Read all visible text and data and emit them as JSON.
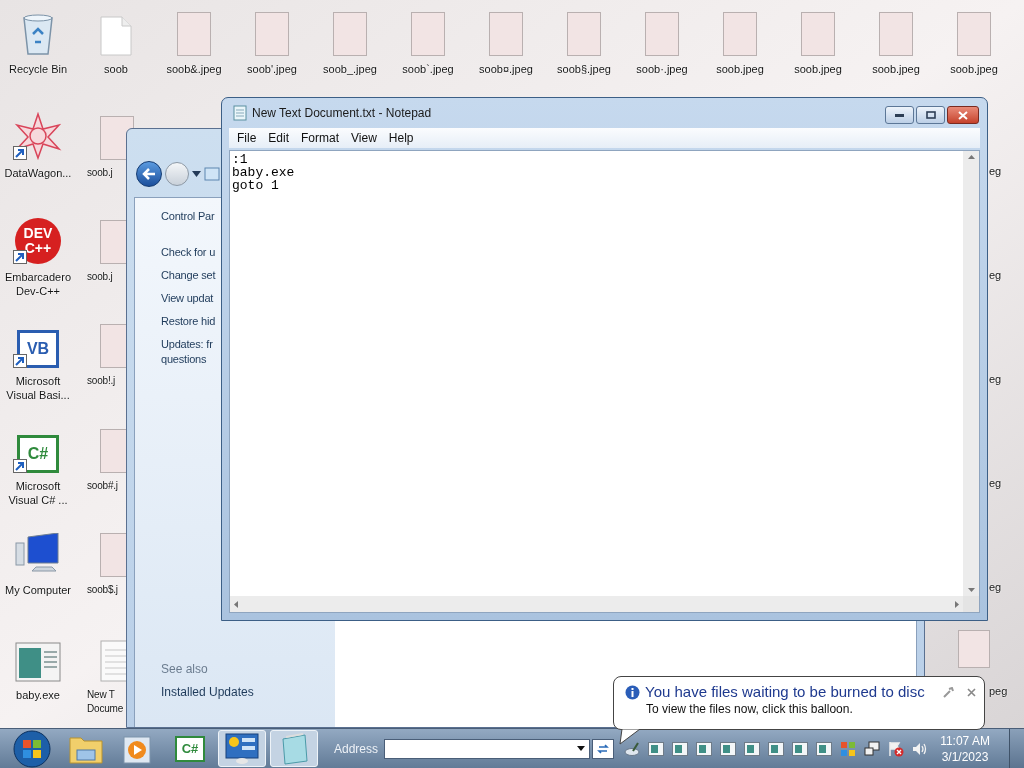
{
  "desktop": {
    "top_row": [
      {
        "kind": "recycle-bin",
        "label": [
          "Recycle Bin"
        ]
      },
      {
        "kind": "blank-file",
        "label": [
          "soob"
        ]
      },
      {
        "kind": "photo",
        "label": [
          "soob&.jpeg"
        ]
      },
      {
        "kind": "photo",
        "label": [
          "soob'.jpeg"
        ]
      },
      {
        "kind": "photo",
        "label": [
          "soob_.jpeg"
        ]
      },
      {
        "kind": "photo",
        "label": [
          "soob`.jpeg"
        ]
      },
      {
        "kind": "photo",
        "label": [
          "soob¤.jpeg"
        ]
      },
      {
        "kind": "photo",
        "label": [
          "soob§.jpeg"
        ]
      },
      {
        "kind": "photo",
        "label": [
          "soob·.jpeg"
        ]
      },
      {
        "kind": "photo",
        "label": [
          "soob.jpeg"
        ]
      },
      {
        "kind": "photo",
        "label": [
          "soob.jpeg"
        ]
      },
      {
        "kind": "photo",
        "label": [
          "soob.jpeg"
        ]
      },
      {
        "kind": "photo",
        "label": [
          "soob.jpeg"
        ]
      }
    ],
    "left_column": [
      {
        "kind": "datawagon",
        "label": [
          "DataWagon..."
        ],
        "shortcut": true
      },
      {
        "kind": "devcpp",
        "label": [
          "Embarcadero",
          "Dev-C++"
        ],
        "logo_text": [
          "DEV",
          "C++"
        ],
        "shortcut": true
      },
      {
        "kind": "vb",
        "label": [
          "Microsoft",
          "Visual Basi..."
        ],
        "logo_text": [
          "VB"
        ],
        "shortcut": true
      },
      {
        "kind": "csharp",
        "label": [
          "Microsoft",
          "Visual C# ..."
        ],
        "logo_text": [
          "C#"
        ],
        "shortcut": true
      },
      {
        "kind": "computer",
        "label": [
          "My Computer"
        ],
        "shortcut": false
      },
      {
        "kind": "exe",
        "label": [
          "baby.exe"
        ],
        "shortcut": false
      }
    ],
    "second_column": [
      {
        "kind": "photo",
        "label": [
          "soob.j"
        ]
      },
      {
        "kind": "photo",
        "label": [
          "soob.j"
        ]
      },
      {
        "kind": "photo",
        "label": [
          "soob!.j"
        ]
      },
      {
        "kind": "photo",
        "label": [
          "soob#.j"
        ]
      },
      {
        "kind": "photo",
        "label": [
          "soob$.j"
        ]
      },
      {
        "kind": "text-file",
        "label": [
          "New T",
          "Docume"
        ]
      }
    ],
    "right_column": [
      {
        "kind": "hidden",
        "label": "eg"
      },
      {
        "kind": "hidden",
        "label": "eg"
      },
      {
        "kind": "hidden",
        "label": "eg"
      },
      {
        "kind": "hidden",
        "label": "eg"
      },
      {
        "kind": "hidden",
        "label": "eg"
      },
      {
        "kind": "photo",
        "label": "peg"
      }
    ]
  },
  "control_panel": {
    "heading": "Control Par",
    "links": [
      [
        "Check for u"
      ],
      [
        "Change set"
      ],
      [
        "View updat"
      ],
      [
        "Restore hid"
      ],
      [
        "Updates: fr",
        "questions"
      ]
    ],
    "see_also": "See also",
    "see_also_links": [
      "Installed Updates"
    ]
  },
  "notepad": {
    "title": "New Text Document.txt - Notepad",
    "menu": [
      "File",
      "Edit",
      "Format",
      "View",
      "Help"
    ],
    "lines": [
      ":1",
      "baby.exe",
      "goto 1"
    ]
  },
  "balloon": {
    "title": "You have files waiting to be burned to disc",
    "body": "To view the files now, click this balloon."
  },
  "taskbar": {
    "buttons": [
      {
        "kind": "start",
        "active": false
      },
      {
        "kind": "explorer",
        "active": false
      },
      {
        "kind": "media",
        "active": false
      },
      {
        "kind": "csharp",
        "active": false,
        "logo_text": "C#"
      },
      {
        "kind": "control-panel",
        "active": true
      },
      {
        "kind": "notepad",
        "active": true
      }
    ],
    "address_label": "Address",
    "tray": [
      {
        "kind": "burn"
      },
      {
        "kind": "app"
      },
      {
        "kind": "app"
      },
      {
        "kind": "app"
      },
      {
        "kind": "app"
      },
      {
        "kind": "app"
      },
      {
        "kind": "app"
      },
      {
        "kind": "app"
      },
      {
        "kind": "app"
      },
      {
        "kind": "windows"
      },
      {
        "kind": "network"
      },
      {
        "kind": "flag-error"
      },
      {
        "kind": "volume"
      }
    ],
    "time": "11:07 AM",
    "date": "3/1/2023"
  }
}
